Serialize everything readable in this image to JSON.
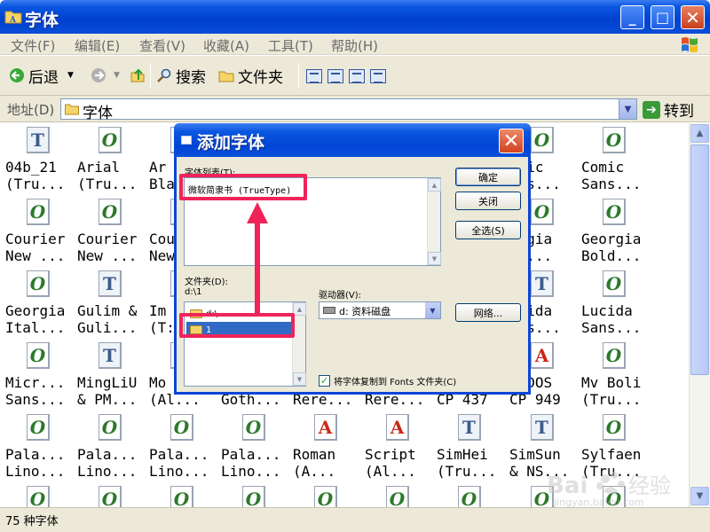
{
  "window": {
    "title": "字体"
  },
  "menu": [
    "文件(F)",
    "编辑(E)",
    "查看(V)",
    "收藏(A)",
    "工具(T)",
    "帮助(H)"
  ],
  "toolbar": {
    "back_label": "后退",
    "search_label": "搜索",
    "folders_label": "文件夹"
  },
  "address": {
    "label": "地址(D)",
    "value": "字体",
    "go_label": "转到"
  },
  "fonts": [
    {
      "line1": "04b_21",
      "line2": "(Tru...",
      "icon": "T"
    },
    {
      "line1": "Arial",
      "line2": "(Tru...",
      "icon": "O"
    },
    {
      "line1": "Ar",
      "line2": "Bla",
      "icon": "O"
    },
    {
      "line1": "",
      "line2": "",
      "icon": "O"
    },
    {
      "line1": "",
      "line2": "",
      "icon": "O"
    },
    {
      "line1": "",
      "line2": "",
      "icon": "O"
    },
    {
      "line1": "",
      "line2": "",
      "icon": "O"
    },
    {
      "line1": "omic",
      "line2": "ans...",
      "icon": "O"
    },
    {
      "line1": "Comic",
      "line2": "Sans...",
      "icon": "O"
    },
    {
      "line1": "Courier",
      "line2": "New ...",
      "icon": "O"
    },
    {
      "line1": "Courier",
      "line2": "New ...",
      "icon": "O"
    },
    {
      "line1": "Cou",
      "line2": "New",
      "icon": "O"
    },
    {
      "line1": "",
      "line2": "",
      "icon": "O"
    },
    {
      "line1": "",
      "line2": "",
      "icon": "O"
    },
    {
      "line1": "",
      "line2": "",
      "icon": "O"
    },
    {
      "line1": "",
      "line2": "",
      "icon": "O"
    },
    {
      "line1": "orgia",
      "line2": "ld...",
      "icon": "O"
    },
    {
      "line1": "Georgia",
      "line2": "Bold...",
      "icon": "O"
    },
    {
      "line1": "Georgia",
      "line2": "Ital...",
      "icon": "O"
    },
    {
      "line1": "Gulim &",
      "line2": "Guli...",
      "icon": "T"
    },
    {
      "line1": "Im",
      "line2": "(T:",
      "icon": "O"
    },
    {
      "line1": "",
      "line2": "",
      "icon": "O"
    },
    {
      "line1": "",
      "line2": "",
      "icon": "O"
    },
    {
      "line1": "",
      "line2": "",
      "icon": "O"
    },
    {
      "line1": "",
      "line2": "",
      "icon": "O"
    },
    {
      "line1": "ucida",
      "line2": "ans...",
      "icon": "T"
    },
    {
      "line1": "Lucida",
      "line2": "Sans...",
      "icon": "O"
    },
    {
      "line1": "Micr...",
      "line2": "Sans...",
      "icon": "O"
    },
    {
      "line1": "MingLiU",
      "line2": "& PM...",
      "icon": "T"
    },
    {
      "line1": "Mo",
      "line2": "(Al...",
      "icon": "O"
    },
    {
      "line1": "",
      "line2": "Goth...",
      "icon": "O"
    },
    {
      "line1": "",
      "line2": "Rere...",
      "icon": "O"
    },
    {
      "line1": "",
      "line2": "Rere...",
      "icon": "O"
    },
    {
      "line1": "",
      "line2": "CP 437",
      "icon": "A"
    },
    {
      "line1": "S-DOS",
      "line2": "CP 949",
      "icon": "A"
    },
    {
      "line1": "Mv Boli",
      "line2": "(Tru...",
      "icon": "O"
    },
    {
      "line1": "Pala...",
      "line2": "Lino...",
      "icon": "O"
    },
    {
      "line1": "Pala...",
      "line2": "Lino...",
      "icon": "O"
    },
    {
      "line1": "Pala...",
      "line2": "Lino...",
      "icon": "O"
    },
    {
      "line1": "Pala...",
      "line2": "Lino...",
      "icon": "O"
    },
    {
      "line1": "Roman",
      "line2": "(A...",
      "icon": "A"
    },
    {
      "line1": "Script",
      "line2": "(Al...",
      "icon": "A"
    },
    {
      "line1": "SimHei",
      "line2": "(Tru...",
      "icon": "T"
    },
    {
      "line1": "SimSun",
      "line2": "& NS...",
      "icon": "T"
    },
    {
      "line1": "Sylfaen",
      "line2": "(Tru...",
      "icon": "O"
    },
    {
      "line1": "",
      "line2": "",
      "icon": "O"
    },
    {
      "line1": "",
      "line2": "",
      "icon": "O"
    },
    {
      "line1": "",
      "line2": "",
      "icon": "O"
    },
    {
      "line1": "",
      "line2": "",
      "icon": "O"
    },
    {
      "line1": "",
      "line2": "",
      "icon": "O"
    },
    {
      "line1": "",
      "line2": "",
      "icon": "O"
    },
    {
      "line1": "",
      "line2": "",
      "icon": "O"
    },
    {
      "line1": "",
      "line2": "",
      "icon": "O"
    },
    {
      "line1": "",
      "line2": "",
      "icon": "O"
    }
  ],
  "status": {
    "text": "75 种字体"
  },
  "dialog": {
    "title": "添加字体",
    "font_list_label": "字体列表(T):",
    "font_list_item": "微软简隶书 (TrueType)",
    "folders_label": "文件夹(D):",
    "current_path": "d:\\1",
    "folder_items": [
      "d:\\",
      "1"
    ],
    "drives_label": "驱动器(V):",
    "drive_value": "d: 资料磁盘",
    "ok_label": "确定",
    "close_label": "关闭",
    "select_all_label": "全选(S)",
    "network_label": "网络...",
    "copy_checkbox_label": "将字体复制到 Fonts 文件夹(C)",
    "copy_checked": true
  },
  "watermark": {
    "text": "jingyan.baidu.com"
  },
  "colors": {
    "highlight": "#f0245a",
    "titlebar": "#0a56e0",
    "selection": "#316ac5"
  }
}
